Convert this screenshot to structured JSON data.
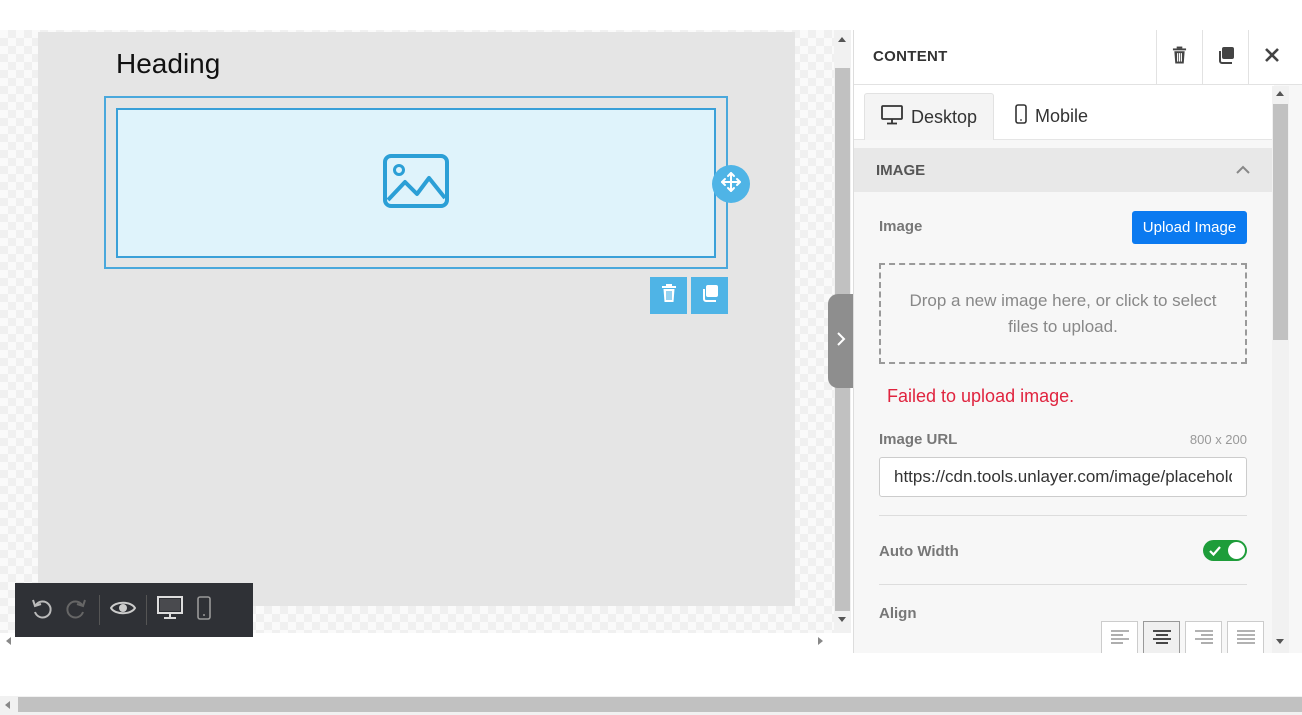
{
  "canvas": {
    "heading": "Heading",
    "image_placeholder_icon": "image-icon",
    "move_icon": "move-icon",
    "delete_icon": "trash-icon",
    "duplicate_icon": "duplicate-icon"
  },
  "toolbar": {
    "undo_icon": "undo-icon",
    "redo_icon": "redo-icon",
    "preview_icon": "eye-icon",
    "desktop_icon": "desktop-icon",
    "mobile_icon": "mobile-icon"
  },
  "panel": {
    "title": "CONTENT",
    "tabs": [
      {
        "label": "Desktop",
        "icon": "desktop-icon",
        "active": true
      },
      {
        "label": "Mobile",
        "icon": "mobile-icon",
        "active": false
      }
    ],
    "section_title": "IMAGE",
    "image_label": "Image",
    "upload_button": "Upload Image",
    "dropzone_text": "Drop a new image here, or click to select files to upload.",
    "error_text": "Failed to upload image.",
    "image_url_label": "Image URL",
    "image_dimensions": "800 x 200",
    "image_url_value": "https://cdn.tools.unlayer.com/image/placeholder.png",
    "auto_width_label": "Auto Width",
    "auto_width_on": true,
    "align_label": "Align",
    "align_options": [
      "left",
      "center",
      "right",
      "justify"
    ],
    "align_selected": "center"
  },
  "colors": {
    "accent": "#4fb4e6",
    "primary_button": "#0b7af0",
    "error": "#e0243f",
    "toggle_on": "#1e9d3a",
    "toolbar_bg": "#2f3136"
  }
}
